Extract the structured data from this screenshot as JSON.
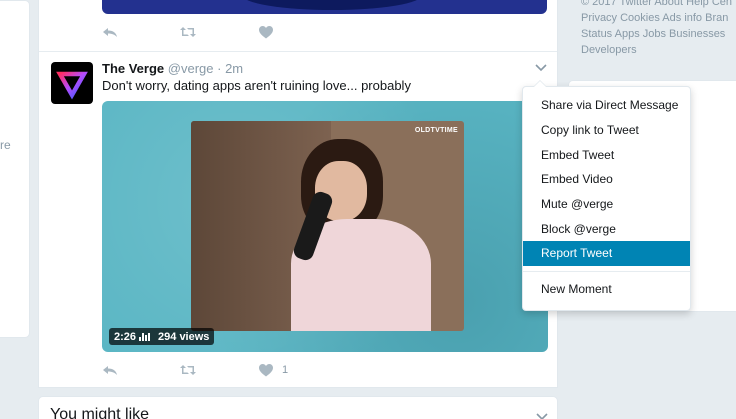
{
  "left_fragment": "re",
  "previous_tweet": {
    "actions": {
      "reply": "reply-icon",
      "retweet": "retweet-icon",
      "like": "heart-icon"
    }
  },
  "tweet": {
    "name": "The Verge",
    "handle": "@verge",
    "separator": "·",
    "time": "2m",
    "text": "Don't worry, dating apps aren't ruining love... probably",
    "media": {
      "watermark": "OLDTVTIME",
      "duration": "2:26",
      "views": "294 views"
    },
    "like_count": "1"
  },
  "menu": {
    "items": [
      "Share via Direct Message",
      "Copy link to Tweet",
      "Embed Tweet",
      "Embed Video",
      "Mute @verge",
      "Block @verge",
      "Report Tweet"
    ],
    "active_item": "Report Tweet",
    "footer_item": "New Moment"
  },
  "footer_links": {
    "line1": "© 2017 Twitter  About  Help Cen",
    "line2": "Privacy  Cookies  Ads info  Bran",
    "line3": "Status  Apps  Jobs  Businesses",
    "line4": "Developers"
  },
  "bottom_card": {
    "title": "You might like"
  },
  "colors": {
    "accent": "#0084b4",
    "background": "#e6ecf0",
    "muted": "#8899a6"
  }
}
